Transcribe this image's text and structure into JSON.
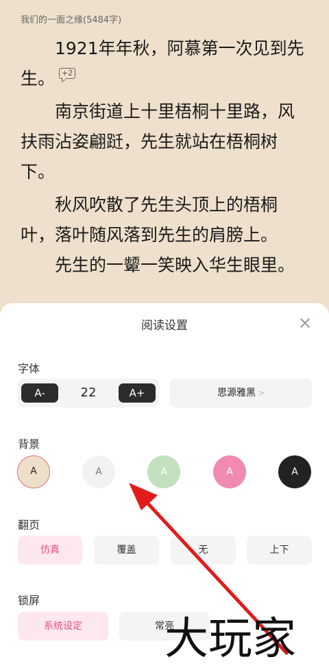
{
  "reader": {
    "chapter_title": "我们的一面之缘(5484字)",
    "paragraphs": [
      "1921年年秋，阿慕第一次见到先生。",
      "南京街道上十里梧桐十里路，风扶雨沾姿翩跹，先生就站在梧桐树下。",
      "秋风吹散了先生头顶上的梧桐叶，落叶随风落到先生的肩膀上。",
      "先生的一颦一笑映入华生眼里。"
    ],
    "comment_count": "+2"
  },
  "settings": {
    "title": "阅读设置",
    "font": {
      "label": "字体",
      "decrease_label": "A-",
      "size": "22",
      "increase_label": "A+",
      "family": "思源雅黑"
    },
    "background": {
      "label": "背景",
      "swatches": [
        {
          "letter": "A",
          "color": "#eedfc8",
          "selected": true
        },
        {
          "letter": "A",
          "color": "#f2f2f2"
        },
        {
          "letter": "A",
          "color": "#c3dfc0"
        },
        {
          "letter": "A",
          "color": "#f08ab0"
        },
        {
          "letter": "A",
          "color": "#222222"
        }
      ]
    },
    "page_turn": {
      "label": "翻页",
      "options": [
        "仿真",
        "覆盖",
        "无",
        "上下"
      ],
      "selected": "仿真"
    },
    "lock_screen": {
      "label": "锁屏",
      "options": [
        "系统设定",
        "常亮"
      ],
      "selected": "系统设定"
    }
  },
  "watermark": "大玩家",
  "colors": {
    "accent": "#e5527f",
    "arrow": "#e21b1b"
  }
}
